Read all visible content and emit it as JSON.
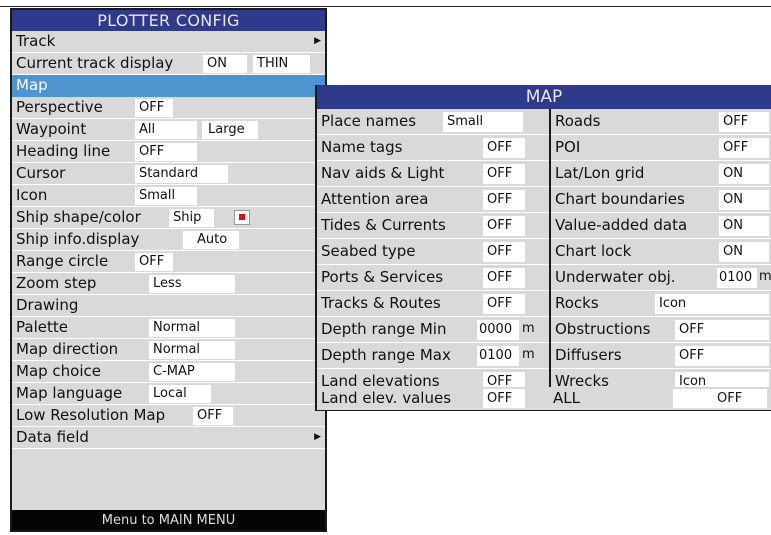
{
  "plotter": {
    "title": "PLOTTER CONFIG",
    "rows": [
      {
        "label": "Track"
      },
      {
        "label": "Current track display",
        "values": [
          "ON",
          "THIN"
        ]
      },
      {
        "label": "Map"
      },
      {
        "label": "Perspective",
        "values": [
          "OFF"
        ]
      },
      {
        "label": "Waypoint",
        "values": [
          "All",
          "Large"
        ]
      },
      {
        "label": "Heading line",
        "values": [
          "OFF"
        ]
      },
      {
        "label": "Cursor",
        "values": [
          "Standard"
        ]
      },
      {
        "label": "Icon",
        "values": [
          "Small"
        ]
      },
      {
        "label": "Ship shape/color",
        "values": [
          "Ship"
        ]
      },
      {
        "label": "Ship info.display",
        "values": [
          "Auto"
        ]
      },
      {
        "label": "Range circle",
        "values": [
          "OFF"
        ]
      },
      {
        "label": "Zoom step",
        "values": [
          "Less"
        ]
      },
      {
        "label": "Drawing"
      },
      {
        "label": "Palette",
        "values": [
          "Normal"
        ]
      },
      {
        "label": "Map direction",
        "values": [
          "Normal"
        ]
      },
      {
        "label": "Map choice",
        "values": [
          "C-MAP"
        ]
      },
      {
        "label": "Map language",
        "values": [
          "Local"
        ]
      },
      {
        "label": "Low Resolution Map",
        "values": [
          "OFF"
        ]
      },
      {
        "label": "Data field"
      }
    ],
    "footer": "Menu to MAIN MENU"
  },
  "map": {
    "title": "MAP",
    "left": [
      {
        "label": "Place names",
        "value": "Small"
      },
      {
        "label": "Name tags",
        "value": "OFF"
      },
      {
        "label": "Nav aids & Light",
        "value": "OFF"
      },
      {
        "label": "Attention area",
        "value": "OFF"
      },
      {
        "label": "Tides & Currents",
        "value": "OFF"
      },
      {
        "label": "Seabed type",
        "value": "OFF"
      },
      {
        "label": "Ports & Services",
        "value": "OFF"
      },
      {
        "label": "Tracks & Routes",
        "value": "OFF"
      },
      {
        "label": "Depth range Min",
        "value": "0000",
        "unit": "m"
      },
      {
        "label": "Depth range Max",
        "value": "0100",
        "unit": "m"
      },
      {
        "label": "Land elevations",
        "value": "OFF"
      },
      {
        "label": "Land elev. values",
        "value": "OFF"
      }
    ],
    "right": [
      {
        "label": "Roads",
        "value": "OFF"
      },
      {
        "label": "POI",
        "value": "OFF"
      },
      {
        "label": "Lat/Lon grid",
        "value": "ON"
      },
      {
        "label": "Chart boundaries",
        "value": "ON"
      },
      {
        "label": "Value-added data",
        "value": "ON"
      },
      {
        "label": "Chart lock",
        "value": "ON"
      },
      {
        "label": "Underwater obj.",
        "value": "0100",
        "unit": "m"
      },
      {
        "label": "Rocks",
        "value": "Icon"
      },
      {
        "label": "Obstructions",
        "value": "OFF"
      },
      {
        "label": "Diffusers",
        "value": "OFF"
      },
      {
        "label": "Wrecks",
        "value": "Icon"
      },
      {
        "label": "ALL",
        "value": "OFF"
      }
    ]
  },
  "colors": {
    "title_bar": "#2f3a8a",
    "selected_row": "#4e95cf",
    "panel_bg": "#d9d9d9",
    "ship_color": "#e01010"
  },
  "icons": {
    "submenu_arrow": "triangle-right-icon",
    "ship_color_swatch": "red-square-icon"
  }
}
